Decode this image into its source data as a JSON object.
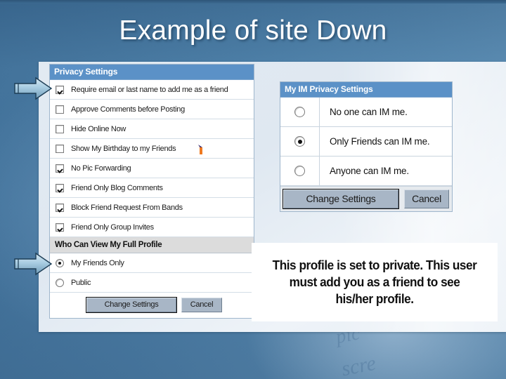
{
  "slide": {
    "title": "Example of site Down",
    "background_color": "#4a7da6",
    "watermark_lines": [
      "pic",
      "scre"
    ]
  },
  "privacy_panel": {
    "header": "Privacy Settings",
    "checkbox_rows": [
      {
        "label": "Require email or last name to add me as a friend",
        "checked": true
      },
      {
        "label": "Approve Comments before Posting",
        "checked": false
      },
      {
        "label": "Hide Online Now",
        "checked": false
      },
      {
        "label": "Show My Birthday to my Friends",
        "checked": false
      },
      {
        "label": "No Pic Forwarding",
        "checked": true
      },
      {
        "label": "Friend Only Blog Comments",
        "checked": true
      },
      {
        "label": "Block Friend Request From Bands",
        "checked": true
      },
      {
        "label": "Friend Only Group Invites",
        "checked": true
      }
    ],
    "subheader": "Who Can View My Full Profile",
    "radio_rows": [
      {
        "label": "My Friends Only",
        "selected": true
      },
      {
        "label": "Public",
        "selected": false
      }
    ],
    "buttons": {
      "submit": "Change Settings",
      "cancel": "Cancel"
    }
  },
  "im_panel": {
    "header": "My IM Privacy Settings",
    "options": [
      {
        "label": "No one can IM me.",
        "selected": false
      },
      {
        "label": "Only Friends can IM me.",
        "selected": true
      },
      {
        "label": "Anyone can IM me.",
        "selected": false
      }
    ],
    "buttons": {
      "submit": "Change Settings",
      "cancel": "Cancel"
    }
  },
  "private_notice": {
    "line1": "This profile is set to private. This user must add",
    "line2": "you as a friend to see his/her profile."
  },
  "annotations": {
    "arrow_color_light": "#b8d4e6",
    "arrow_color_dark": "#6f9bb8",
    "marker_color": "#ef7a21"
  }
}
